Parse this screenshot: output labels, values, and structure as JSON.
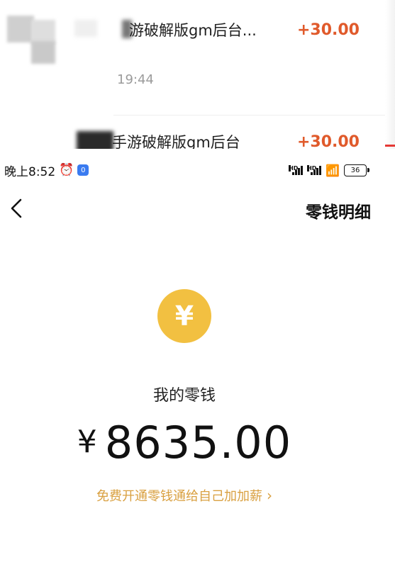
{
  "transactions": [
    {
      "title": "游破解版gm后台...",
      "amount": "+30.00",
      "time": "19:44"
    },
    {
      "title": "手游破解版gm后台",
      "amount": "+30.00"
    }
  ],
  "status_bar": {
    "time": "晚上8:52",
    "alarm_icon": "alarm-clock-icon",
    "app_badge": "0",
    "hd1": "HD",
    "hd2": "HD",
    "battery": "36"
  },
  "nav": {
    "back_icon": "chevron-left-icon",
    "title": "零钱明细"
  },
  "wallet": {
    "coin_symbol": "¥",
    "label": "我的零钱",
    "currency": "¥",
    "balance": "8635.00",
    "promo": "免费开通零钱通给自己加加薪",
    "promo_chevron": "›"
  },
  "colors": {
    "accent_gold": "#f2c041",
    "promo_text": "#d9a041",
    "amount_orange": "#e05a2b"
  }
}
